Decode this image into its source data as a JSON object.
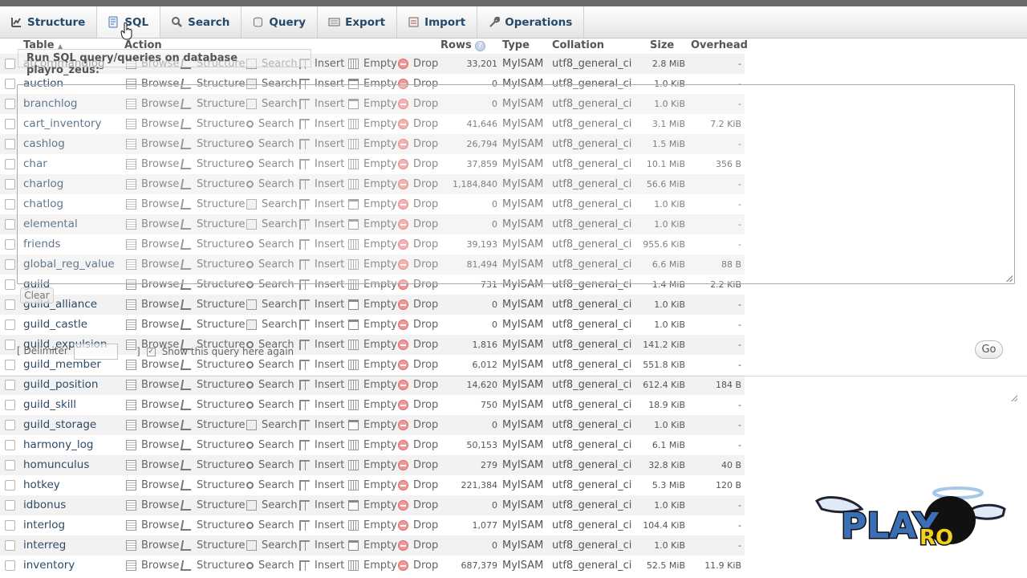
{
  "tabs": [
    {
      "label": "Structure",
      "icon": "structure-icon",
      "active": false
    },
    {
      "label": "SQL",
      "icon": "sql-icon",
      "active": true
    },
    {
      "label": "Search",
      "icon": "search-icon",
      "active": false
    },
    {
      "label": "Query",
      "icon": "query-icon",
      "active": false
    },
    {
      "label": "Export",
      "icon": "export-icon",
      "active": false
    },
    {
      "label": "Import",
      "icon": "import-icon",
      "active": false
    },
    {
      "label": "Operations",
      "icon": "wrench-icon",
      "active": false
    }
  ],
  "headers": {
    "table": "Table",
    "action": "Action",
    "rows": "Rows",
    "type": "Type",
    "collation": "Collation",
    "size": "Size",
    "overhead": "Overhead"
  },
  "actions": {
    "browse": "Browse",
    "structure": "Structure",
    "search": "Search",
    "insert": "Insert",
    "empty": "Empty",
    "drop": "Drop"
  },
  "sql_overlay": {
    "title": "Run SQL query/queries on database playro_zeus:",
    "clear_label": "Clear",
    "delimiter_label": "[ Delimiter",
    "delimiter_close": "]",
    "show_query_label": "Show this query here again",
    "go_label": "Go"
  },
  "tables": [
    {
      "name": "atcommandlog",
      "rows": "33,201",
      "type": "MyISAM",
      "collation": "utf8_general_ci",
      "size": "2.8 MiB",
      "overhead": "-",
      "search_icon": 1,
      "empty_icon": 1
    },
    {
      "name": "auction",
      "rows": "0",
      "type": "MyISAM",
      "collation": "utf8_general_ci",
      "size": "1.0 KiB",
      "overhead": "-",
      "search_icon": 1,
      "empty_icon": 2
    },
    {
      "name": "branchlog",
      "rows": "0",
      "type": "MyISAM",
      "collation": "utf8_general_ci",
      "size": "1.0 KiB",
      "overhead": "-",
      "search_icon": 1,
      "empty_icon": 2
    },
    {
      "name": "cart_inventory",
      "rows": "41,646",
      "type": "MyISAM",
      "collation": "utf8_general_ci",
      "size": "3.1 MiB",
      "overhead": "7.2 KiB",
      "search_icon": 2,
      "empty_icon": 1
    },
    {
      "name": "cashlog",
      "rows": "26,794",
      "type": "MyISAM",
      "collation": "utf8_general_ci",
      "size": "1.5 MiB",
      "overhead": "-",
      "search_icon": 2,
      "empty_icon": 1
    },
    {
      "name": "char",
      "rows": "37,859",
      "type": "MyISAM",
      "collation": "utf8_general_ci",
      "size": "10.1 MiB",
      "overhead": "356 B",
      "search_icon": 2,
      "empty_icon": 1
    },
    {
      "name": "charlog",
      "rows": "1,184,840",
      "type": "MyISAM",
      "collation": "utf8_general_ci",
      "size": "56.6 MiB",
      "overhead": "-",
      "search_icon": 2,
      "empty_icon": 1
    },
    {
      "name": "chatlog",
      "rows": "0",
      "type": "MyISAM",
      "collation": "utf8_general_ci",
      "size": "1.0 KiB",
      "overhead": "-",
      "search_icon": 1,
      "empty_icon": 2
    },
    {
      "name": "elemental",
      "rows": "0",
      "type": "MyISAM",
      "collation": "utf8_general_ci",
      "size": "1.0 KiB",
      "overhead": "-",
      "search_icon": 1,
      "empty_icon": 2
    },
    {
      "name": "friends",
      "rows": "39,193",
      "type": "MyISAM",
      "collation": "utf8_general_ci",
      "size": "955.6 KiB",
      "overhead": "-",
      "search_icon": 2,
      "empty_icon": 1
    },
    {
      "name": "global_reg_value",
      "rows": "81,494",
      "type": "MyISAM",
      "collation": "utf8_general_ci",
      "size": "6.6 MiB",
      "overhead": "88 B",
      "search_icon": 2,
      "empty_icon": 1
    },
    {
      "name": "guild",
      "rows": "731",
      "type": "MyISAM",
      "collation": "utf8_general_ci",
      "size": "1.4 MiB",
      "overhead": "2.2 KiB",
      "search_icon": 2,
      "empty_icon": 1
    },
    {
      "name": "guild_alliance",
      "rows": "0",
      "type": "MyISAM",
      "collation": "utf8_general_ci",
      "size": "1.0 KiB",
      "overhead": "-",
      "search_icon": 1,
      "empty_icon": 2
    },
    {
      "name": "guild_castle",
      "rows": "0",
      "type": "MyISAM",
      "collation": "utf8_general_ci",
      "size": "1.0 KiB",
      "overhead": "-",
      "search_icon": 1,
      "empty_icon": 2
    },
    {
      "name": "guild_expulsion",
      "rows": "1,816",
      "type": "MyISAM",
      "collation": "utf8_general_ci",
      "size": "141.2 KiB",
      "overhead": "-",
      "search_icon": 2,
      "empty_icon": 1
    },
    {
      "name": "guild_member",
      "rows": "6,012",
      "type": "MyISAM",
      "collation": "utf8_general_ci",
      "size": "551.8 KiB",
      "overhead": "-",
      "search_icon": 2,
      "empty_icon": 1
    },
    {
      "name": "guild_position",
      "rows": "14,620",
      "type": "MyISAM",
      "collation": "utf8_general_ci",
      "size": "612.4 KiB",
      "overhead": "184 B",
      "search_icon": 2,
      "empty_icon": 1
    },
    {
      "name": "guild_skill",
      "rows": "750",
      "type": "MyISAM",
      "collation": "utf8_general_ci",
      "size": "18.9 KiB",
      "overhead": "-",
      "search_icon": 2,
      "empty_icon": 1
    },
    {
      "name": "guild_storage",
      "rows": "0",
      "type": "MyISAM",
      "collation": "utf8_general_ci",
      "size": "1.0 KiB",
      "overhead": "-",
      "search_icon": 1,
      "empty_icon": 2
    },
    {
      "name": "harmony_log",
      "rows": "50,153",
      "type": "MyISAM",
      "collation": "utf8_general_ci",
      "size": "6.1 MiB",
      "overhead": "-",
      "search_icon": 2,
      "empty_icon": 1
    },
    {
      "name": "homunculus",
      "rows": "279",
      "type": "MyISAM",
      "collation": "utf8_general_ci",
      "size": "32.8 KiB",
      "overhead": "40 B",
      "search_icon": 2,
      "empty_icon": 1
    },
    {
      "name": "hotkey",
      "rows": "221,384",
      "type": "MyISAM",
      "collation": "utf8_general_ci",
      "size": "5.3 MiB",
      "overhead": "120 B",
      "search_icon": 2,
      "empty_icon": 1
    },
    {
      "name": "idbonus",
      "rows": "0",
      "type": "MyISAM",
      "collation": "utf8_general_ci",
      "size": "1.0 KiB",
      "overhead": "-",
      "search_icon": 1,
      "empty_icon": 2
    },
    {
      "name": "interlog",
      "rows": "1,077",
      "type": "MyISAM",
      "collation": "utf8_general_ci",
      "size": "104.4 KiB",
      "overhead": "-",
      "search_icon": 2,
      "empty_icon": 1
    },
    {
      "name": "interreg",
      "rows": "0",
      "type": "MyISAM",
      "collation": "utf8_general_ci",
      "size": "1.0 KiB",
      "overhead": "-",
      "search_icon": 1,
      "empty_icon": 2
    },
    {
      "name": "inventory",
      "rows": "687,379",
      "type": "MyISAM",
      "collation": "utf8_general_ci",
      "size": "52.5 MiB",
      "overhead": "11.9 KiB",
      "search_icon": 2,
      "empty_icon": 1
    }
  ],
  "logo": {
    "text_main": "PLAY",
    "text_sub": "RO"
  }
}
